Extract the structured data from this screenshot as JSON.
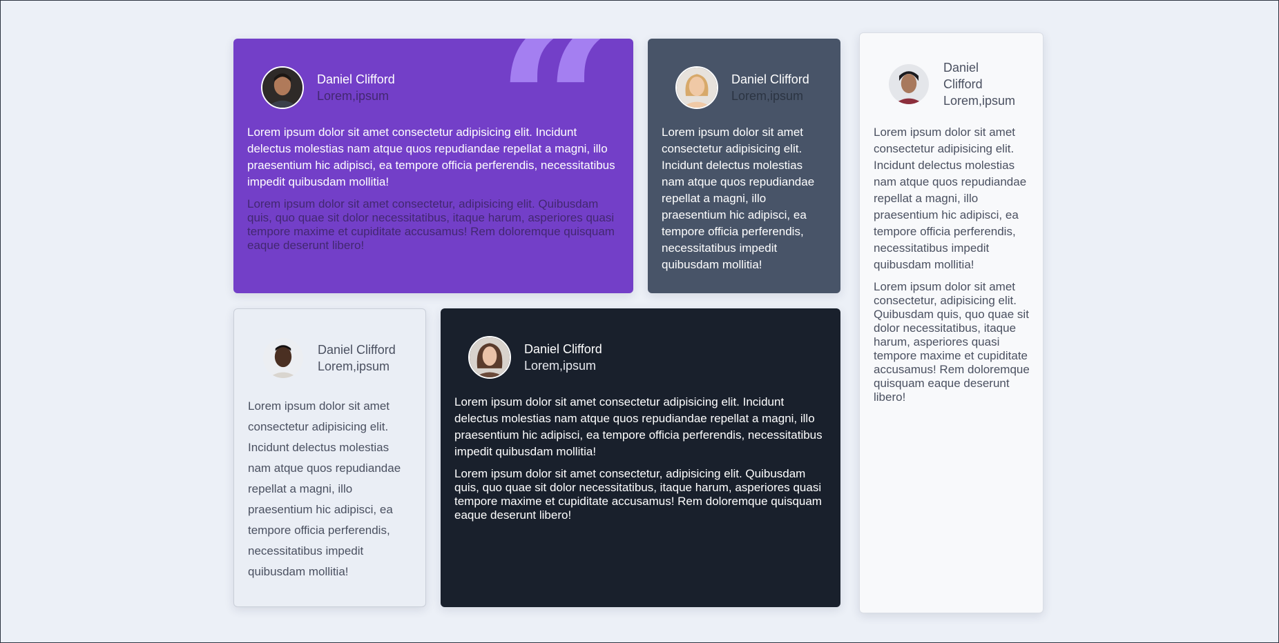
{
  "cards": [
    {
      "name": "Daniel Clifford",
      "subtitle": "Lorem,ipsum",
      "paragraph1": "Lorem ipsum dolor sit amet consectetur adipisicing elit. Incidunt delectus molestias nam atque quos repudiandae repellat a magni, illo praesentium hic adipisci, ea tempore officia perferendis, necessitatibus impedit quibusdam mollitia!",
      "paragraph2": "Lorem ipsum dolor sit amet consectetur, adipisicing elit. Quibusdam quis, quo quae sit dolor necessitatibus, itaque harum, asperiores quasi tempore maxime et cupiditate accusamus! Rem doloremque quisquam eaque deserunt libero!"
    },
    {
      "name": "Daniel Clifford",
      "subtitle": "Lorem,ipsum",
      "paragraph1": "Lorem ipsum dolor sit amet consectetur adipisicing elit. Incidunt delectus molestias nam atque quos repudiandae repellat a magni, illo praesentium hic adipisci, ea tempore officia perferendis, necessitatibus impedit quibusdam mollitia!"
    },
    {
      "name": "Daniel Clifford",
      "subtitle": "Lorem,ipsum",
      "paragraph1": "Lorem ipsum dolor sit amet consectetur adipisicing elit. Incidunt delectus molestias nam atque quos repudiandae repellat a magni, illo praesentium hic adipisci, ea tempore officia perferendis, necessitatibus impedit quibusdam mollitia!",
      "paragraph2": "Lorem ipsum dolor sit amet consectetur, adipisicing elit. Quibusdam quis, quo quae sit dolor necessitatibus, itaque harum, asperiores quasi tempore maxime et cupiditate accusamus! Rem doloremque quisquam eaque deserunt libero!"
    },
    {
      "name": "Daniel Clifford",
      "subtitle": "Lorem,ipsum",
      "paragraph1": "Lorem ipsum dolor sit amet consectetur adipisicing elit. Incidunt delectus molestias nam atque quos repudiandae repellat a magni, illo praesentium hic adipisci, ea tempore officia perferendis, necessitatibus impedit quibusdam mollitia!"
    },
    {
      "name": "Daniel Clifford",
      "subtitle": "Lorem,ipsum",
      "paragraph1": "Lorem ipsum dolor sit amet consectetur adipisicing elit. Incidunt delectus molestias nam atque quos repudiandae repellat a magni, illo praesentium hic adipisci, ea tempore officia perferendis, necessitatibus impedit quibusdam mollitia!",
      "paragraph2": "Lorem ipsum dolor sit amet consectetur, adipisicing elit. Quibusdam quis, quo quae sit dolor necessitatibus, itaque harum, asperiores quasi tempore maxime et cupiditate accusamus! Rem doloremque quisquam eaque deserunt libero!"
    }
  ],
  "decoration": {
    "quote_icon": "quote-icon"
  },
  "colors": {
    "background": "#ecf0f7",
    "purple_card": "#733fc8",
    "slate_card": "#485468",
    "white_card": "#f8f9fb",
    "dark_card": "#19202c",
    "quote_mark": "#a47ff1"
  }
}
